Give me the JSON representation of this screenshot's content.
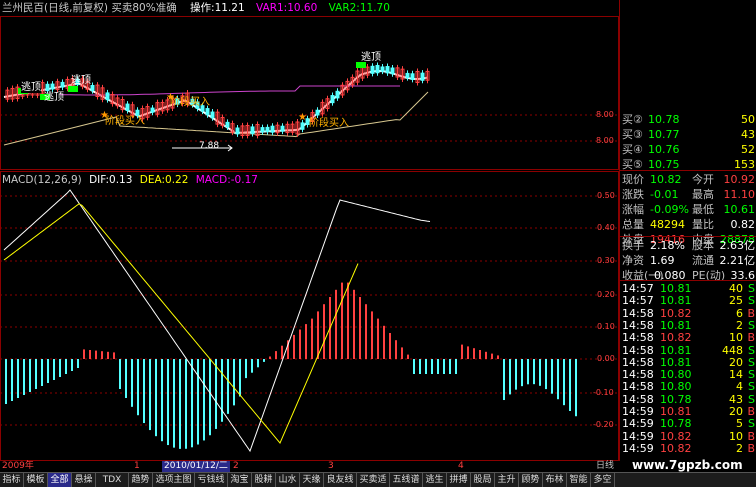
{
  "header": {
    "title": "兰州民百(日线,前复权)",
    "indicator_name": "买卖80%准确",
    "op_label": "操作:11.21",
    "var1_label": "VAR1:10.60",
    "var2_label": "VAR2:11.70"
  },
  "price_panel": {
    "y_ticks": [
      "8.00",
      "8.00"
    ],
    "low_label": "7.88",
    "annotations": {
      "escape_top_1": "逃顶",
      "escape_top_2": "逃顶",
      "escape_top_3": "逃顶",
      "escape_top_4": "逃顶",
      "buy_1": "阶段买入",
      "buy_2": "阶段买入",
      "buy_3": "阶段买入"
    }
  },
  "macd_panel": {
    "label_name": "MACD(12,26,9)",
    "dif_label": "DIF:0.13",
    "dea_label": "DEA:0.22",
    "macd_label": "MACD:-0.17",
    "y_ticks": [
      "0.50",
      "0.40",
      "0.30",
      "0.20",
      "0.10",
      "0.00",
      "-0.10",
      "-0.20"
    ]
  },
  "quote": {
    "bids": [
      {
        "label": "买②",
        "price": "10.78",
        "vol": "50"
      },
      {
        "label": "买③",
        "price": "10.77",
        "vol": "43"
      },
      {
        "label": "买④",
        "price": "10.76",
        "vol": "52"
      },
      {
        "label": "买⑤",
        "price": "10.75",
        "vol": "153"
      }
    ],
    "stats": [
      {
        "l1": "现价",
        "v1": "10.82",
        "l2": "今开",
        "v2": "10.92"
      },
      {
        "l1": "涨跌",
        "v1": "-0.01",
        "l2": "最高",
        "v2": "11.10"
      },
      {
        "l1": "涨幅",
        "v1": "-0.09%",
        "l2": "最低",
        "v2": "10.61"
      },
      {
        "l1": "总量",
        "v1": "48294",
        "l2": "量比",
        "v2": "0.82"
      },
      {
        "l1": "外盘",
        "v1": "19416",
        "l2": "内盘",
        "v2": "28878"
      }
    ],
    "fund": [
      {
        "l1": "换手",
        "v1": "2.18%",
        "l2": "股本",
        "v2": "2.63亿"
      },
      {
        "l1": "净资",
        "v1": "1.69",
        "l2": "流通",
        "v2": "2.21亿"
      },
      {
        "l1": "收益(一)",
        "v1": "0.080",
        "l2": "PE(动)",
        "v2": "33.6"
      }
    ],
    "ticks": [
      {
        "time": "14:57",
        "price": "10.81",
        "vol": "40",
        "dir": "S"
      },
      {
        "time": "14:57",
        "price": "10.81",
        "vol": "25",
        "dir": "S"
      },
      {
        "time": "14:58",
        "price": "10.82",
        "vol": "6",
        "dir": "B"
      },
      {
        "time": "14:58",
        "price": "10.81",
        "vol": "2",
        "dir": "S"
      },
      {
        "time": "14:58",
        "price": "10.82",
        "vol": "10",
        "dir": "B"
      },
      {
        "time": "14:58",
        "price": "10.81",
        "vol": "448",
        "dir": "S"
      },
      {
        "time": "14:58",
        "price": "10.81",
        "vol": "20",
        "dir": "S"
      },
      {
        "time": "14:58",
        "price": "10.80",
        "vol": "14",
        "dir": "S"
      },
      {
        "time": "14:58",
        "price": "10.80",
        "vol": "4",
        "dir": "S"
      },
      {
        "time": "14:58",
        "price": "10.78",
        "vol": "43",
        "dir": "S"
      },
      {
        "time": "14:59",
        "price": "10.81",
        "vol": "20",
        "dir": "B"
      },
      {
        "time": "14:59",
        "price": "10.78",
        "vol": "5",
        "dir": "S"
      },
      {
        "time": "14:59",
        "price": "10.82",
        "vol": "10",
        "dir": "B"
      },
      {
        "time": "14:59",
        "price": "10.82",
        "vol": "2",
        "dir": "B"
      }
    ]
  },
  "dateline": {
    "year": "2009年",
    "m1": "1",
    "cursor_date": "2010/01/12/二",
    "m2": "2",
    "m3": "3",
    "m4": "4",
    "right": "日线"
  },
  "tabs": [
    "指标",
    "模板",
    "全部",
    "悬操",
    "TDX",
    "趋势",
    "选项主图",
    "亏钱线",
    "淘宝",
    "股耕",
    "山水",
    "天缘",
    "良友线",
    "买卖适",
    "五线谱",
    "逃生",
    "拼搏",
    "股局",
    "主升",
    "顾势",
    "布林",
    "智能",
    "多空"
  ],
  "watermark": "www.7gpzb.com",
  "colors": {
    "up": "#ff4040",
    "down": "#54ffff",
    "grid": "#8b0000",
    "yellow": "#ffff00",
    "green": "#00ff00",
    "magenta": "#ff00ff",
    "orange": "#ff9900"
  }
}
